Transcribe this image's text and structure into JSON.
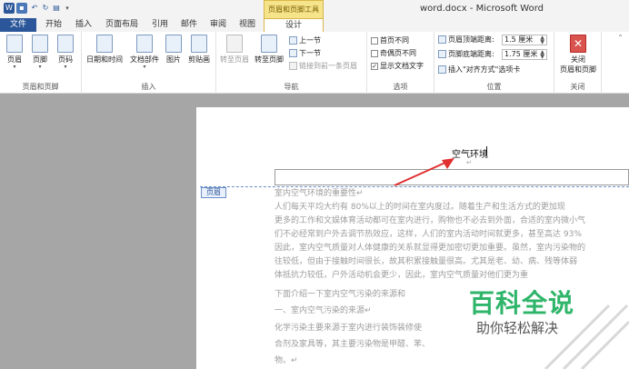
{
  "window": {
    "context_title": "页眉和页脚工具",
    "doc_title": "word.docx - Microsoft Word"
  },
  "tabs": [
    "文件",
    "开始",
    "插入",
    "页面布局",
    "引用",
    "邮件",
    "审阅",
    "视图",
    "设计"
  ],
  "ribbon": {
    "group1": {
      "label": "页眉和页脚",
      "buttons": [
        "页眉",
        "页脚",
        "页码"
      ]
    },
    "group2": {
      "label": "插入",
      "buttons": [
        "日期和时间",
        "文档部件",
        "图片",
        "剪贴画"
      ]
    },
    "group3": {
      "label": "导航",
      "buttons": [
        "转至页眉",
        "转至页脚"
      ],
      "prev": "上一节",
      "next": "下一节",
      "link": "链接到前一条页眉"
    },
    "group4": {
      "label": "选项",
      "opt1": "首页不同",
      "opt2": "奇偶页不同",
      "opt3": "显示文档文字"
    },
    "group5": {
      "label": "位置",
      "header_dist_label": "页眉顶端距离:",
      "header_dist_value": "1.5 厘米",
      "footer_dist_label": "页脚底端距离:",
      "footer_dist_value": "1.75 厘米",
      "insert_align": "插入\"对齐方式\"选项卡"
    },
    "group6": {
      "label": "关闭",
      "close_line1": "关闭",
      "close_line2": "页眉和页脚"
    }
  },
  "document": {
    "header_text": "空气环境",
    "header_label": "页眉",
    "paragraph_mark": "↵",
    "lines": [
      "室内空气环境的重要性↵",
      "    人们每天平均大约有 80%以上的时间在室内度过。随着生产和生活方式的更加现",
      "更多的工作和文娱体育活动都可在室内进行，购物也不必去到外面，合适的室内微小气",
      "们不必经常到户外去调节热效应，这样，人们的室内活动时间就更多，甚至高达 93%",
      "因此，室内空气质量对人体健康的关系就显得更加密切更加重要。虽然，室内污染物的",
      "往较低，但由于接触时间很长，故其积累接触量很高。尤其是老、幼、病、残等体弱",
      "体抵抗力较低，户外活动机会更少，因此，室内空气质量对他们更为重",
      "    下面介绍一下室内空气污染的来源和",
      "一、室内空气污染的来源↵",
      "化学污染主要来源于室内进行装饰装修使",
      "合剂及家具等，其主要污染物是甲醛、苯、",
      "物。↵"
    ]
  },
  "watermark": {
    "title": "百科全说",
    "subtitle": "助你轻松解决"
  }
}
